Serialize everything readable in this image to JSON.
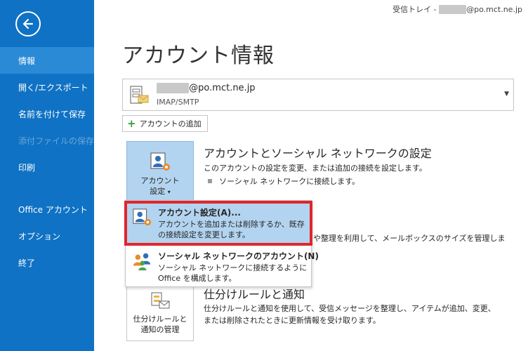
{
  "header": {
    "inbox_prefix": "受信トレイ - ",
    "inbox_email_hidden": "xxxxxx",
    "inbox_email_domain": "@po.mct.ne.jp"
  },
  "sidebar": {
    "back_icon": "back-arrow-icon",
    "items": [
      {
        "label": "情報",
        "active": true
      },
      {
        "label": "開く/エクスポート"
      },
      {
        "label": "名前を付けて保存"
      },
      {
        "label": "添付ファイルの保存",
        "disabled": true
      },
      {
        "label": "印刷"
      },
      {
        "label": "Office アカウント"
      },
      {
        "label": "オプション"
      },
      {
        "label": "終了"
      }
    ]
  },
  "main": {
    "title": "アカウント情報",
    "account_selector": {
      "email_hidden": "xxxxxx",
      "email_domain": "@po.mct.ne.jp",
      "type": "IMAP/SMTP"
    },
    "add_account_label": "アカウントの追加",
    "account_settings": {
      "tile_line1": "アカウント",
      "tile_line2": "設定",
      "tile_arrow": "▾",
      "heading": "アカウントとソーシャル ネットワークの設定",
      "desc": "このアカウントの設定を変更、または追加の接続を設定します。",
      "bullet": "ソーシャル ネットワークに接続します。"
    },
    "mailbox": {
      "desc_partial": "や整理を利用して、メールボックスのサイズを管理しま"
    },
    "rules": {
      "tile_line1": "仕分けルールと",
      "tile_line2": "通知の管理",
      "heading": "仕分けルールと通知",
      "desc_line1": "仕分けルールと通知を使用して、受信メッセージを整理し、アイテムが追加、変更、",
      "desc_line2": "または削除されたときに更新情報を受け取ります。"
    }
  },
  "menu": {
    "items": [
      {
        "title": "アカウント設定(A)...",
        "desc_line1": "アカウントを追加または削除するか、既存",
        "desc_line2": "の接続設定を変更します。"
      },
      {
        "title": "ソーシャル ネットワークのアカウント(N)",
        "desc_line1": "ソーシャル ネットワークに接続するように",
        "desc_line2": "Office を構成します。"
      }
    ]
  },
  "colors": {
    "sidebar": "#0f72c4",
    "sidebar_active": "#2b8ad6",
    "highlight": "#b3d4f0",
    "focus_outline": "#e0262b"
  }
}
